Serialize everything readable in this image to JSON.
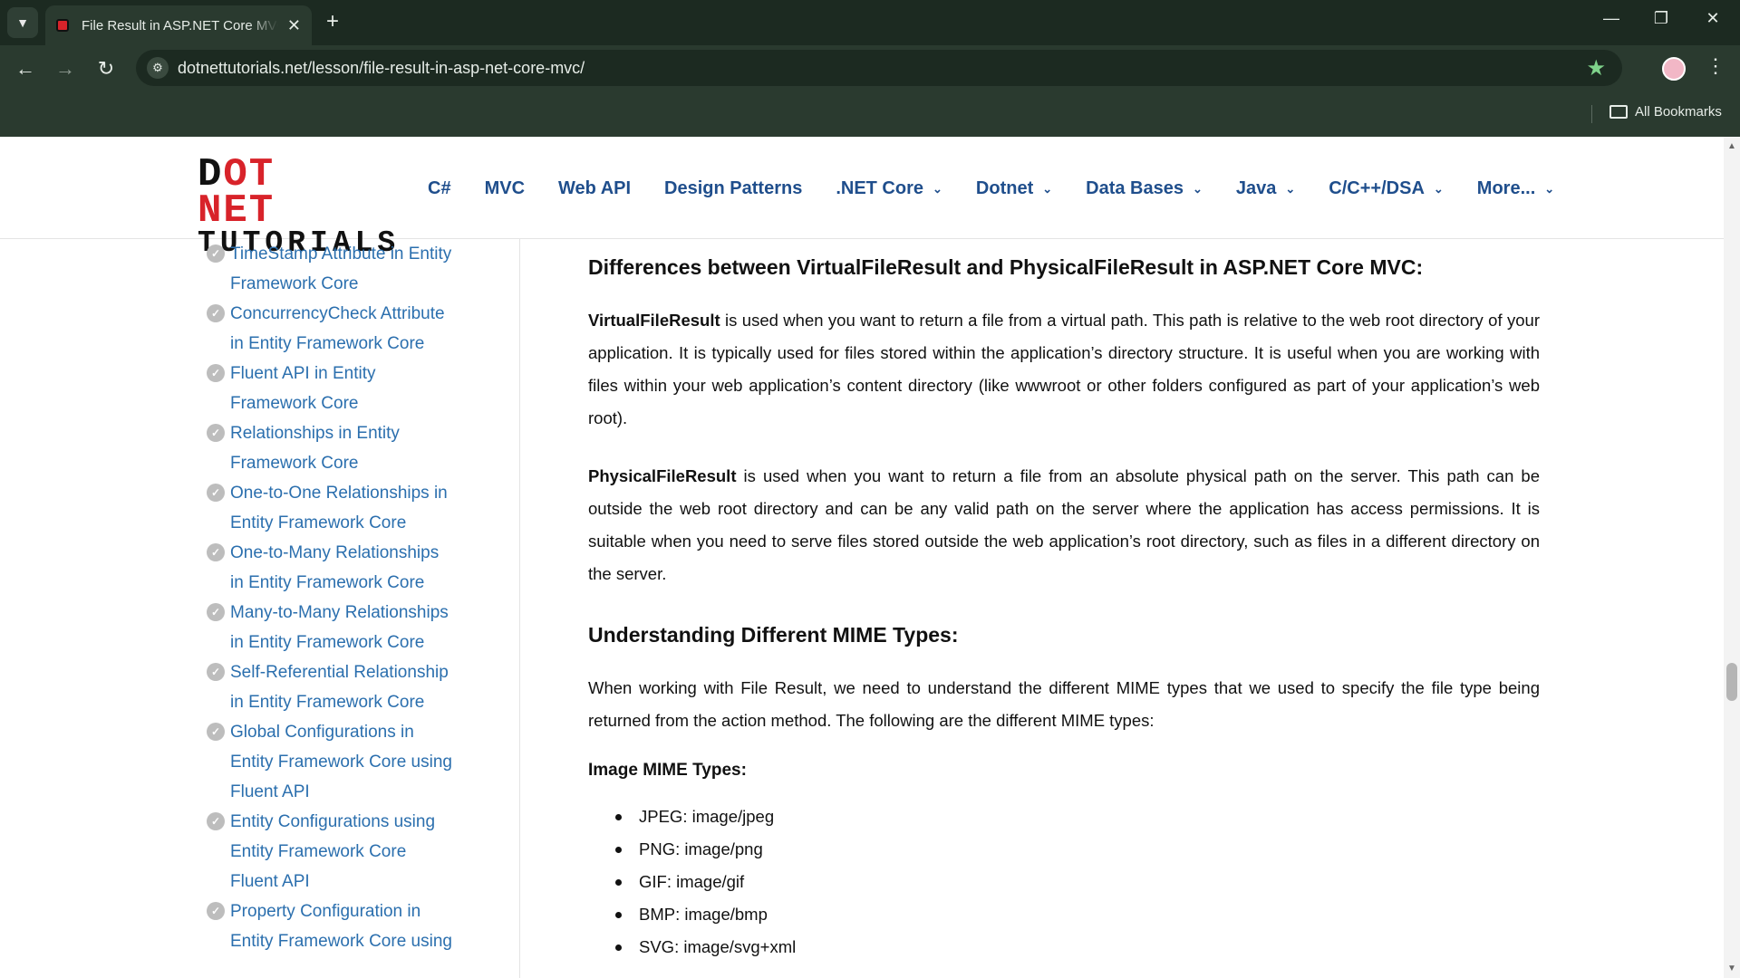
{
  "browser": {
    "tab_title": "File Result in ASP.NET Core MVC",
    "url": "dotnettutorials.net/lesson/file-result-in-asp-net-core-mvc/",
    "bookmarks_label": "All Bookmarks",
    "accent_color": "#7fd38b"
  },
  "site": {
    "logo_top_d": "D",
    "logo_top_rest": "OT NET",
    "logo_bottom": "TUTORIALS",
    "nav": [
      {
        "label": "C#"
      },
      {
        "label": "MVC"
      },
      {
        "label": "Web API"
      },
      {
        "label": "Design Patterns"
      },
      {
        "label": ".NET Core"
      },
      {
        "label": "Dotnet"
      },
      {
        "label": "Data Bases"
      },
      {
        "label": "Java"
      },
      {
        "label": "C/C++/DSA"
      },
      {
        "label": "More..."
      }
    ]
  },
  "sidebar": {
    "items": [
      {
        "label": "TimeStamp Attribute in Entity Framework Core"
      },
      {
        "label": "ConcurrencyCheck Attribute in Entity Framework Core"
      },
      {
        "label": "Fluent API in Entity Framework Core"
      },
      {
        "label": "Relationships in Entity Framework Core"
      },
      {
        "label": "One-to-One Relationships in Entity Framework Core"
      },
      {
        "label": "One-to-Many Relationships in Entity Framework Core"
      },
      {
        "label": "Many-to-Many Relationships in Entity Framework Core"
      },
      {
        "label": "Self-Referential Relationship in Entity Framework Core"
      },
      {
        "label": "Global Configurations in Entity Framework Core using Fluent API"
      },
      {
        "label": "Entity Configurations using Entity Framework Core Fluent API"
      },
      {
        "label": "Property Configuration in Entity Framework Core using"
      }
    ]
  },
  "content": {
    "heading_differences": "Differences between VirtualFileResult and PhysicalFileResult in ASP.NET Core MVC:",
    "virtual_term": "VirtualFileResult",
    "virtual_text": " is used when you want to return a file from a virtual path. This path is relative to the web root directory of your application. It is typically used for files stored within the application’s directory structure. It is useful when you are working with files within your web application’s content directory (like wwwroot or other folders configured as part of your application’s web root).",
    "physical_term": "PhysicalFileResult",
    "physical_text": " is used when you want to return a file from an absolute physical path on the server. This path can be outside the web root directory and can be any valid path on the server where the application has access permissions. It is suitable when you need to serve files stored outside the web application’s root directory, such as files in a different directory on the server.",
    "heading_mime": "Understanding Different MIME Types:",
    "mime_intro": "When working with File Result, we need to understand the different MIME types that we used to specify the file type being returned from the action method. The following are the different MIME types:",
    "image_mime_heading": "Image MIME Types:",
    "image_mime_types": [
      "JPEG: image/jpeg",
      "PNG: image/png",
      "GIF: image/gif",
      "BMP: image/bmp",
      "SVG: image/svg+xml"
    ]
  }
}
